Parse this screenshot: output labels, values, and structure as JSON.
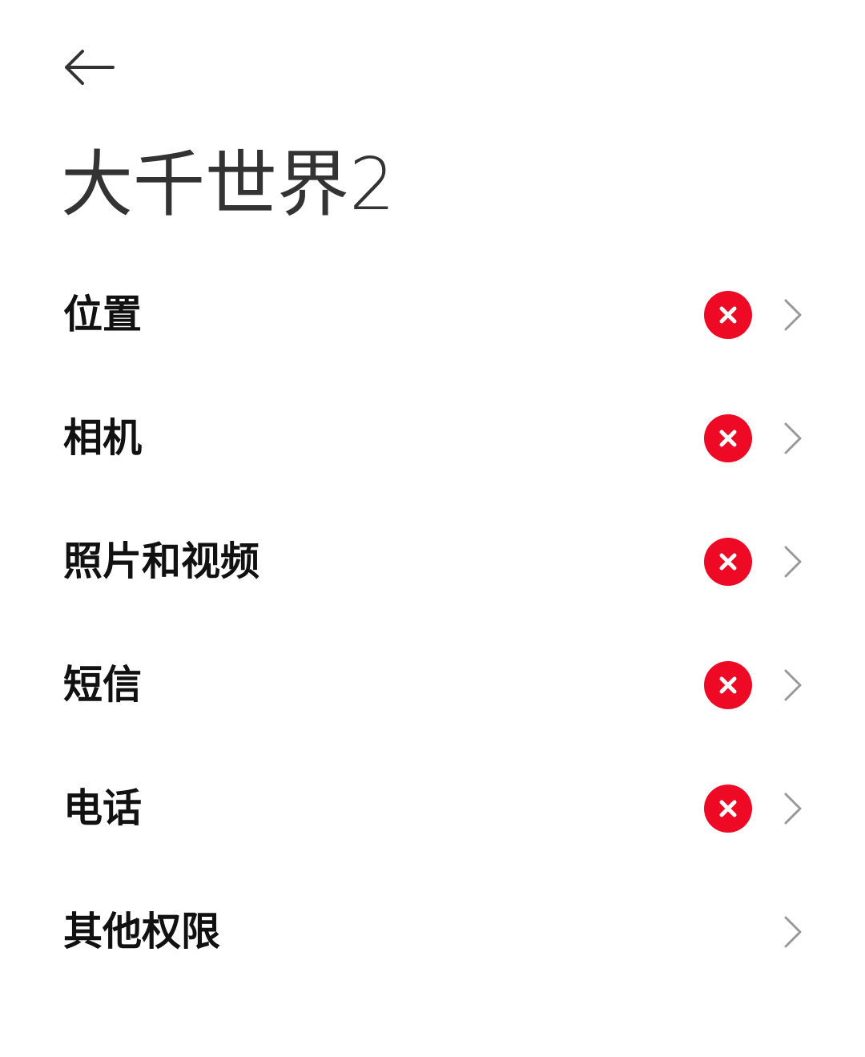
{
  "header": {
    "back_icon": "arrow-left-icon",
    "title": "大千世界2"
  },
  "permissions": [
    {
      "label": "位置",
      "status": "denied",
      "status_icon": "x-circle-icon"
    },
    {
      "label": "相机",
      "status": "denied",
      "status_icon": "x-circle-icon"
    },
    {
      "label": "照片和视频",
      "status": "denied",
      "status_icon": "x-circle-icon"
    },
    {
      "label": "短信",
      "status": "denied",
      "status_icon": "x-circle-icon"
    },
    {
      "label": "电话",
      "status": "denied",
      "status_icon": "x-circle-icon"
    },
    {
      "label": "其他权限",
      "status": "none",
      "status_icon": ""
    }
  ],
  "colors": {
    "denied_red": "#ee0a24",
    "chevron_gray": "#999999",
    "title_gray": "#333333"
  }
}
